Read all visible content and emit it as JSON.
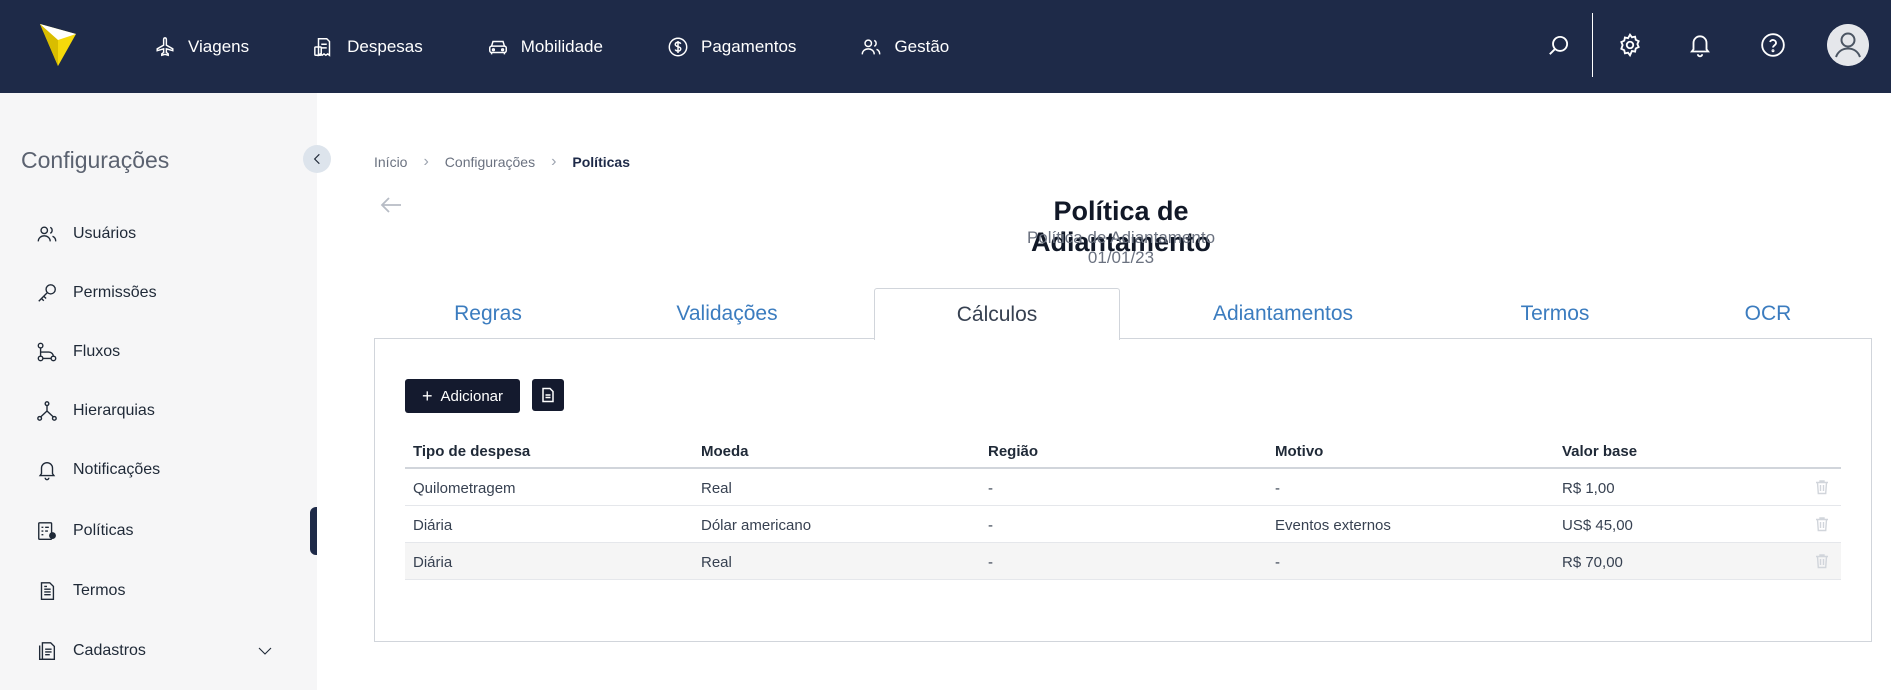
{
  "nav": {
    "items": [
      {
        "label": "Viagens",
        "icon": "airplane-icon"
      },
      {
        "label": "Despesas",
        "icon": "receipt-icon"
      },
      {
        "label": "Mobilidade",
        "icon": "car-icon"
      },
      {
        "label": "Pagamentos",
        "icon": "dollar-coin-icon"
      },
      {
        "label": "Gestão",
        "icon": "users-icon"
      }
    ]
  },
  "sidebar": {
    "title": "Configurações",
    "items": [
      {
        "label": "Usuários",
        "icon": "users-icon"
      },
      {
        "label": "Permissões",
        "icon": "key-icon"
      },
      {
        "label": "Fluxos",
        "icon": "flow-icon"
      },
      {
        "label": "Hierarquias",
        "icon": "hierarchy-icon"
      },
      {
        "label": "Notificações",
        "icon": "bell-icon"
      },
      {
        "label": "Políticas",
        "icon": "policy-icon",
        "active": true
      },
      {
        "label": "Termos",
        "icon": "document-icon"
      },
      {
        "label": "Cadastros",
        "icon": "register-icon",
        "expandable": true
      }
    ]
  },
  "breadcrumb": {
    "items": [
      "Início",
      "Configurações",
      "Políticas"
    ]
  },
  "header": {
    "title": "Política de Adiantamento",
    "subtitle": "Política de Adiantamento",
    "date": "01/01/23"
  },
  "tabs": [
    {
      "label": "Regras"
    },
    {
      "label": "Validações"
    },
    {
      "label": "Cálculos",
      "active": true
    },
    {
      "label": "Adiantamentos"
    },
    {
      "label": "Termos"
    },
    {
      "label": "OCR"
    }
  ],
  "toolbar": {
    "add_label": "Adicionar"
  },
  "table": {
    "columns": [
      "Tipo de despesa",
      "Moeda",
      "Região",
      "Motivo",
      "Valor base"
    ],
    "rows": [
      [
        "Quilometragem",
        "Real",
        "-",
        "-",
        "R$ 1,00"
      ],
      [
        "Diária",
        "Dólar americano",
        "-",
        "Eventos externos",
        "US$ 45,00"
      ],
      [
        "Diária",
        "Real",
        "-",
        "-",
        "R$ 70,00"
      ]
    ]
  },
  "colors": {
    "topbar": "#1e2a48",
    "logo": "#f5d90a",
    "tab_link": "#3b7cbf",
    "primary_button": "#141a2e"
  }
}
